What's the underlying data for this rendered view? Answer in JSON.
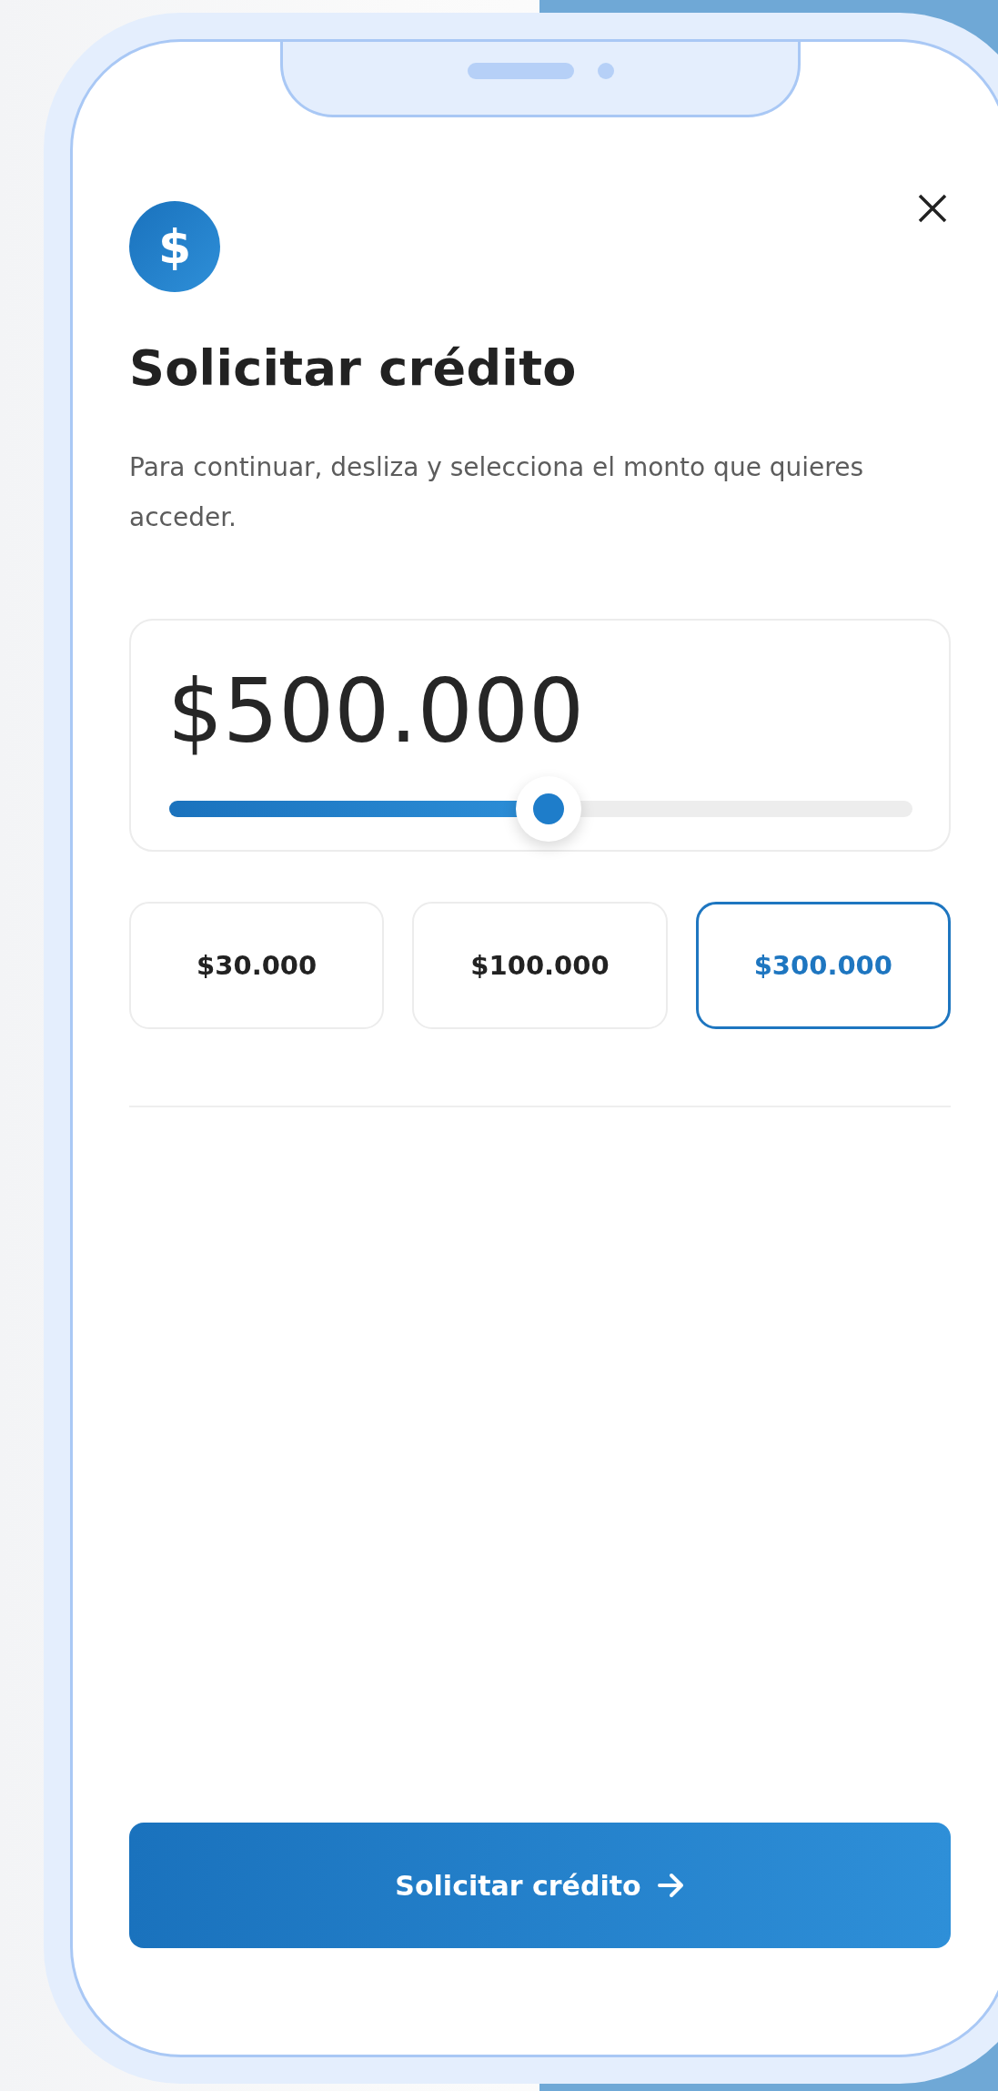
{
  "app_icon": {
    "symbol": "$"
  },
  "title": "Solicitar crédito",
  "description": "Para continuar, desliza y selecciona el monto que quieres acceder.",
  "amount": {
    "value": "$500.000",
    "level": 0.51
  },
  "presets": [
    {
      "label": "$30.000",
      "selected": false
    },
    {
      "label": "$100.000",
      "selected": false
    },
    {
      "label": "$300.000",
      "selected": true
    }
  ],
  "submit": {
    "label": "Solicitar crédito"
  }
}
